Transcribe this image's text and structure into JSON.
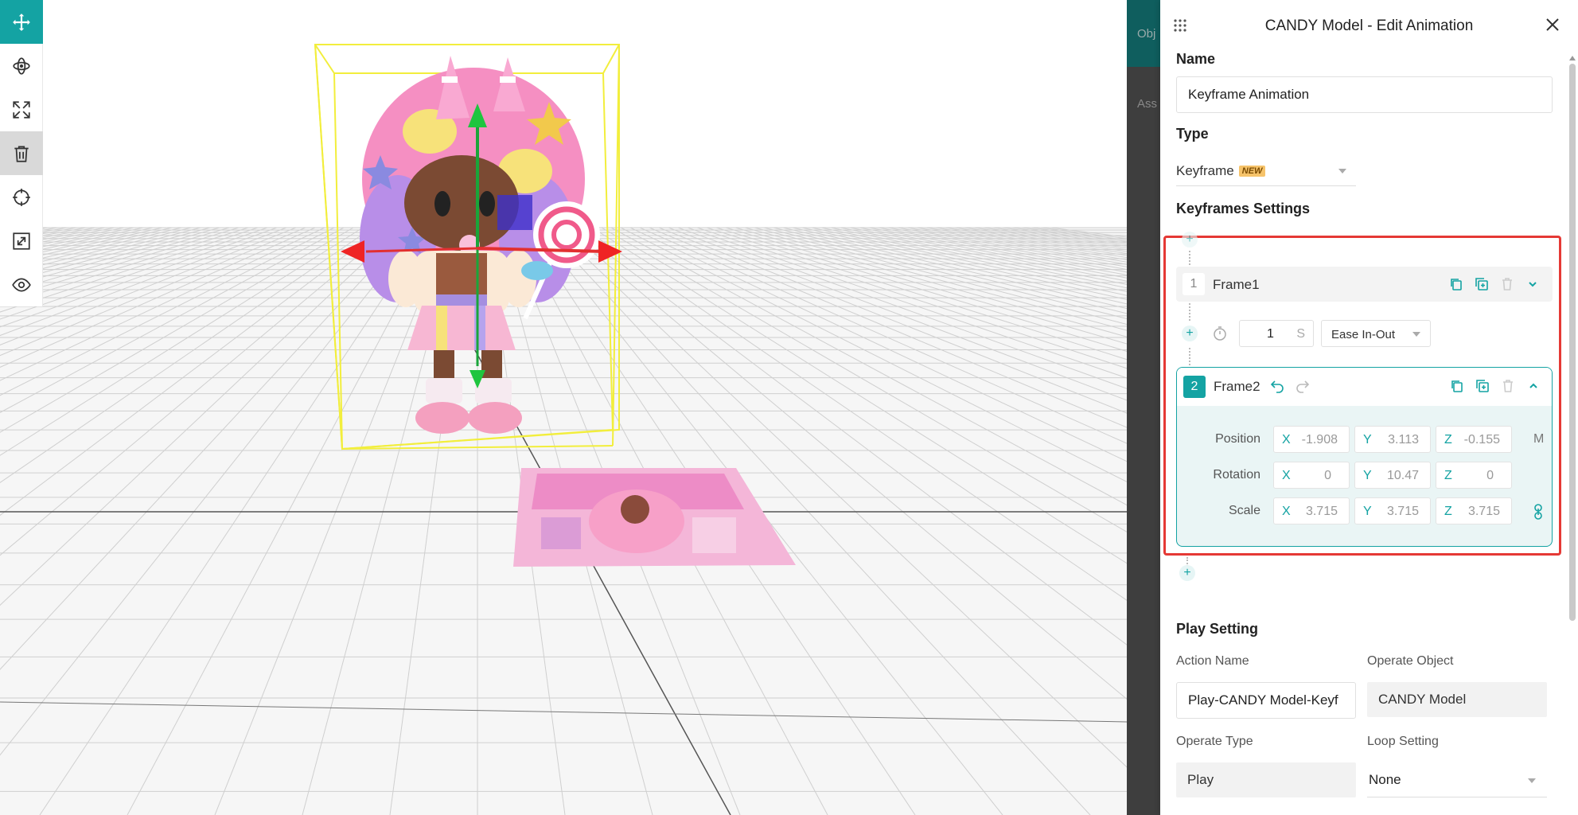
{
  "toolbar": {
    "tools": [
      "move-icon",
      "rotate-icon",
      "scale-icon",
      "trash-icon",
      "target-icon",
      "fit-icon",
      "eye-icon"
    ]
  },
  "background": {
    "tab_partial": "Obj",
    "assets_partial": "Ass"
  },
  "panel": {
    "title": "CANDY Model - Edit Animation",
    "name_label": "Name",
    "name_value": "Keyframe Animation",
    "type_label": "Type",
    "type_value": "Keyframe",
    "type_badge": "NEW",
    "keyframes_label": "Keyframes Settings",
    "frame1": {
      "index": "1",
      "name": "Frame1"
    },
    "transition": {
      "duration": "1",
      "unit": "S",
      "easing": "Ease In-Out"
    },
    "frame2": {
      "index": "2",
      "name": "Frame2",
      "position_label": "Position",
      "rotation_label": "Rotation",
      "scale_label": "Scale",
      "unit_m": "M",
      "position": {
        "x": "-1.908",
        "y": "3.113",
        "z": "-0.155"
      },
      "rotation": {
        "x": "0",
        "y": "10.47",
        "z": "0"
      },
      "scale": {
        "x": "3.715",
        "y": "3.715",
        "z": "3.715"
      },
      "axis_x": "X",
      "axis_y": "Y",
      "axis_z": "Z"
    },
    "play": {
      "heading": "Play Setting",
      "action_name_label": "Action Name",
      "action_name_value": "Play-CANDY Model-Keyf",
      "operate_object_label": "Operate Object",
      "operate_object_value": "CANDY Model",
      "operate_type_label": "Operate Type",
      "operate_type_value": "Play",
      "loop_label": "Loop Setting",
      "loop_value": "None"
    }
  },
  "colors": {
    "accent": "#14a3a3",
    "highlight": "#e53935",
    "selection_box": "#f5f55a"
  }
}
